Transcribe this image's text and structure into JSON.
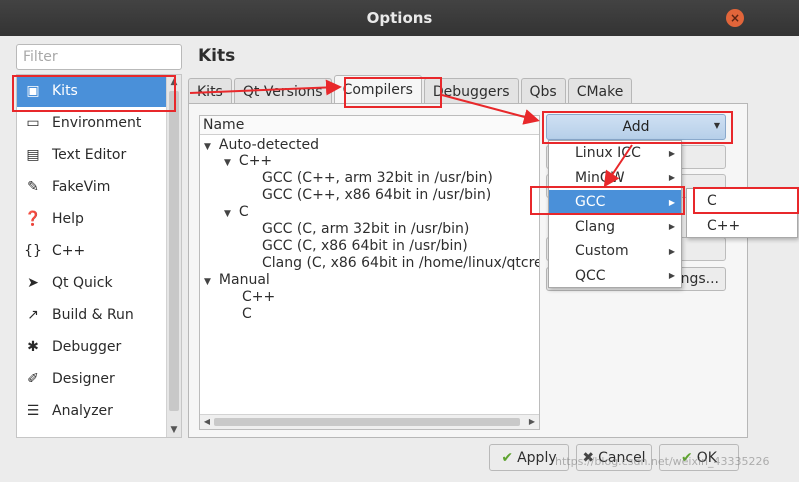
{
  "window": {
    "title": "Options",
    "close_glyph": "×"
  },
  "filter": {
    "placeholder": "Filter"
  },
  "sidebar": {
    "items": [
      {
        "label": "Kits",
        "icon": "kits-icon",
        "glyph": "▣",
        "active": true
      },
      {
        "label": "Environment",
        "icon": "monitor-icon",
        "glyph": "▭"
      },
      {
        "label": "Text Editor",
        "icon": "text-editor-icon",
        "glyph": "▤"
      },
      {
        "label": "FakeVim",
        "icon": "fakevim-icon",
        "glyph": "✎"
      },
      {
        "label": "Help",
        "icon": "help-icon",
        "glyph": "❓"
      },
      {
        "label": "C++",
        "icon": "braces-icon",
        "glyph": "{}"
      },
      {
        "label": "Qt Quick",
        "icon": "paper-plane-icon",
        "glyph": "➤"
      },
      {
        "label": "Build & Run",
        "icon": "hammer-icon",
        "glyph": "↗"
      },
      {
        "label": "Debugger",
        "icon": "bug-icon",
        "glyph": "✱"
      },
      {
        "label": "Designer",
        "icon": "pencil-icon",
        "glyph": "✐"
      },
      {
        "label": "Analyzer",
        "icon": "analyzer-icon",
        "glyph": "☰"
      }
    ]
  },
  "page": {
    "heading": "Kits"
  },
  "tabs": [
    {
      "label": "Kits",
      "active": false
    },
    {
      "label": "Qt Versions",
      "active": false
    },
    {
      "label": "Compilers",
      "active": true
    },
    {
      "label": "Debuggers",
      "active": false
    },
    {
      "label": "Qbs",
      "active": false
    },
    {
      "label": "CMake",
      "active": false
    }
  ],
  "tree": {
    "header": "Name",
    "rows": [
      {
        "label": "Auto-detected",
        "level": 0,
        "expanded": true
      },
      {
        "label": "C++",
        "level": 1,
        "expanded": true
      },
      {
        "label": "GCC (C++, arm 32bit in /usr/bin)",
        "level": 2
      },
      {
        "label": "GCC (C++, x86 64bit in /usr/bin)",
        "level": 2
      },
      {
        "label": "C",
        "level": 1,
        "expanded": true
      },
      {
        "label": "GCC (C, arm 32bit in /usr/bin)",
        "level": 2
      },
      {
        "label": "GCC (C, x86 64bit in /usr/bin)",
        "level": 2
      },
      {
        "label": "Clang (C, x86 64bit in /home/linux/qtcrea",
        "level": 2
      },
      {
        "label": "Manual",
        "level": 0,
        "expanded": true
      },
      {
        "label": "C++",
        "level": 1
      },
      {
        "label": "C",
        "level": 1
      }
    ]
  },
  "add_button": {
    "label": "Add"
  },
  "settings_button": {
    "label": "tings..."
  },
  "add_menu": {
    "items": [
      {
        "label": "Linux ICC",
        "active": false
      },
      {
        "label": "MinGW",
        "active": false
      },
      {
        "label": "GCC",
        "active": true
      },
      {
        "label": "Clang",
        "active": false
      },
      {
        "label": "Custom",
        "active": false
      },
      {
        "label": "QCC",
        "active": false
      }
    ]
  },
  "gcc_submenu": {
    "items": [
      "C",
      "C++"
    ]
  },
  "buttons": {
    "apply": "Apply",
    "cancel": "Cancel",
    "ok": "OK"
  },
  "watermark": "https://blog.csdn.net/weixin_43335226",
  "colors": {
    "highlight": "#4a90d9",
    "annotation": "#e8282b",
    "titlebar": "#3a3a3a"
  }
}
